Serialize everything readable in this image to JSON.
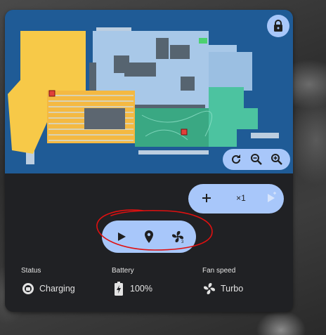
{
  "map": {
    "lock_icon": "lock-icon",
    "controls": [
      "rotate-icon",
      "zoom-out-icon",
      "zoom-in-icon"
    ],
    "colors": {
      "background": "#1f5b96",
      "room_yellow": "#f7c948",
      "room_lightblue": "#a8c8e8",
      "room_green": "#4cc3a0",
      "room_teal": "#3aa883",
      "wall": "#566470"
    }
  },
  "actions": {
    "add_icon": "plus-icon",
    "multiplier": "×1",
    "play_disabled_icon": "play-icon"
  },
  "main_controls": [
    "play-icon",
    "location-pin-icon",
    "fan-icon"
  ],
  "status": {
    "state_label": "Status",
    "state_value": "Charging",
    "battery_label": "Battery",
    "battery_value": "100%",
    "fan_label": "Fan speed",
    "fan_value": "Turbo"
  },
  "accent": "#a8c7fa",
  "annotation_color": "#e01010"
}
